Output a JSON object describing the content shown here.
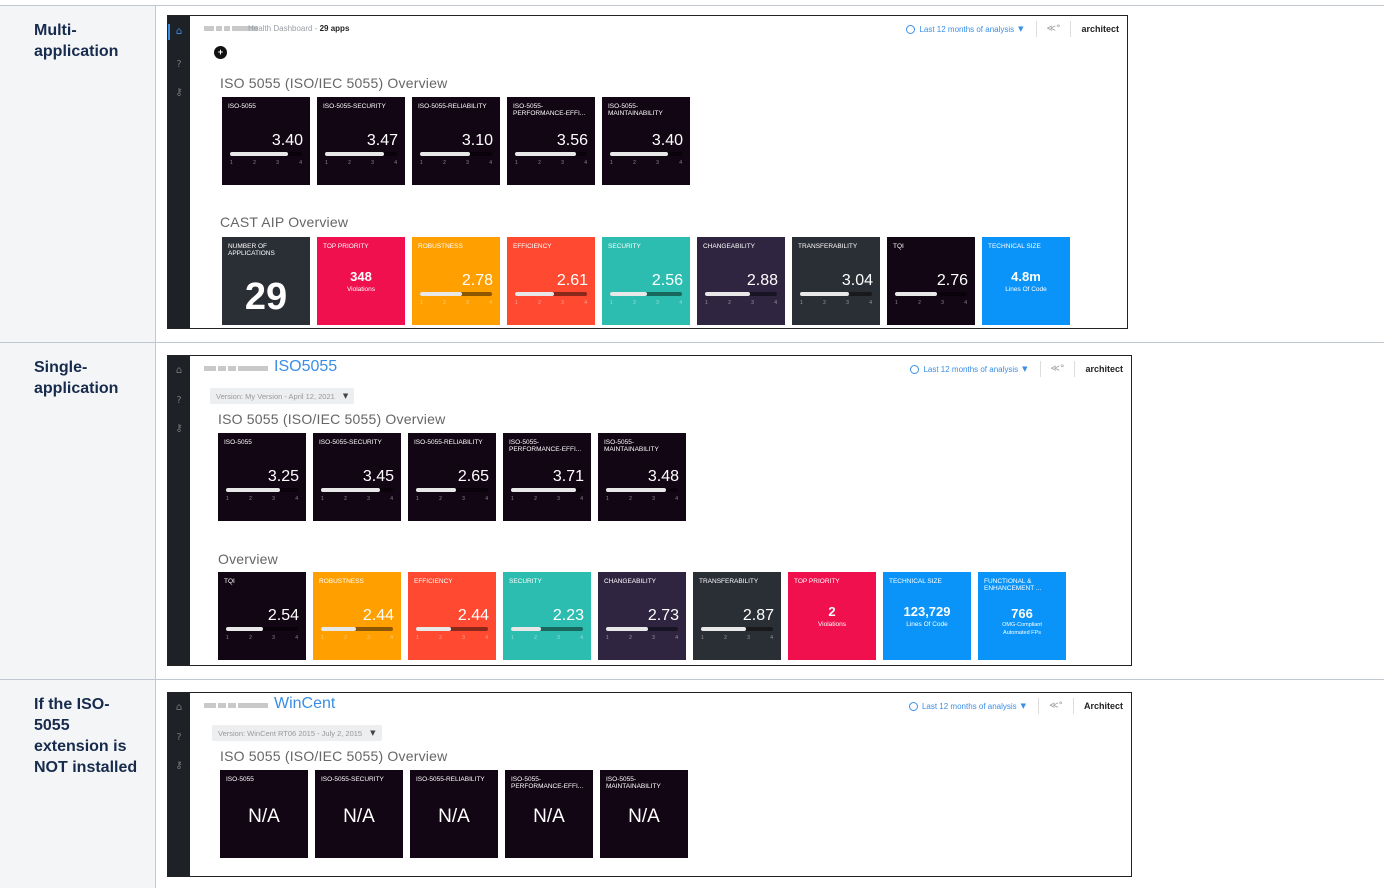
{
  "rows": [
    {
      "label": "Multi-application",
      "breadcrumb_title": "Health Dashboard",
      "breadcrumb_count": "29 apps",
      "period": "Last 12 months of analysis",
      "user": "architect",
      "iso_section_title": "ISO 5055 (ISO/IEC 5055) Overview",
      "iso_tiles": [
        {
          "label": "ISO-5055",
          "value": "3.40",
          "level": 0.8
        },
        {
          "label": "ISO-5055-SECURITY",
          "value": "3.47",
          "level": 0.82
        },
        {
          "label": "ISO-5055-RELIABILITY",
          "value": "3.10",
          "level": 0.7
        },
        {
          "label": "ISO-5055-PERFORMANCE-EFFI...",
          "value": "3.56",
          "level": 0.85
        },
        {
          "label": "ISO-5055-MAINTAINABILITY",
          "value": "3.40",
          "level": 0.8
        }
      ],
      "aip_section_title": "CAST AIP Overview",
      "aip_tiles": [
        {
          "kind": "count",
          "label": "NUMBER OF APPLICATIONS",
          "value": "29",
          "color": "#2a2e35"
        },
        {
          "kind": "count-sub",
          "label": "TOP PRIORITY",
          "value": "348",
          "sub": "Violations",
          "color": "#f0104d"
        },
        {
          "kind": "gauge",
          "label": "ROBUSTNESS",
          "value": "2.78",
          "level": 0.59,
          "color": "#ff9f00"
        },
        {
          "kind": "gauge",
          "label": "EFFICIENCY",
          "value": "2.61",
          "level": 0.54,
          "color": "#ff4930"
        },
        {
          "kind": "gauge",
          "label": "SECURITY",
          "value": "2.56",
          "level": 0.52,
          "color": "#2dbdb0"
        },
        {
          "kind": "gauge",
          "label": "CHANGEABILITY",
          "value": "2.88",
          "level": 0.63,
          "color": "#2f2540"
        },
        {
          "kind": "gauge",
          "label": "TRANSFERABILITY",
          "value": "3.04",
          "level": 0.68,
          "color": "#2a2e35"
        },
        {
          "kind": "gauge",
          "label": "TQI",
          "value": "2.76",
          "level": 0.59,
          "color": "#120514"
        },
        {
          "kind": "count-sub",
          "label": "TECHNICAL SIZE",
          "value": "4.8m",
          "sub": "Lines Of Code",
          "color": "#0a94f9"
        }
      ]
    },
    {
      "label": "Single-application",
      "app_title": "ISO5055",
      "version": "Version: My Version - April 12, 2021",
      "period": "Last 12 months of analysis",
      "user": "architect",
      "iso_section_title": "ISO 5055 (ISO/IEC 5055) Overview",
      "iso_tiles": [
        {
          "label": "ISO-5055",
          "value": "3.25",
          "level": 0.75
        },
        {
          "label": "ISO-5055-SECURITY",
          "value": "3.45",
          "level": 0.82
        },
        {
          "label": "ISO-5055-RELIABILITY",
          "value": "2.65",
          "level": 0.55
        },
        {
          "label": "ISO-5055-PERFORMANCE-EFFI...",
          "value": "3.71",
          "level": 0.9
        },
        {
          "label": "ISO-5055-MAINTAINABILITY",
          "value": "3.48",
          "level": 0.83
        }
      ],
      "aip_section_title": "Overview",
      "aip_tiles": [
        {
          "kind": "gauge",
          "label": "TQI",
          "value": "2.54",
          "level": 0.51,
          "color": "#120514"
        },
        {
          "kind": "gauge",
          "label": "ROBUSTNESS",
          "value": "2.44",
          "level": 0.48,
          "color": "#ff9f00"
        },
        {
          "kind": "gauge",
          "label": "EFFICIENCY",
          "value": "2.44",
          "level": 0.48,
          "color": "#ff4930"
        },
        {
          "kind": "gauge",
          "label": "SECURITY",
          "value": "2.23",
          "level": 0.41,
          "color": "#2dbdb0"
        },
        {
          "kind": "gauge",
          "label": "CHANGEABILITY",
          "value": "2.73",
          "level": 0.58,
          "color": "#2f2540"
        },
        {
          "kind": "gauge",
          "label": "TRANSFERABILITY",
          "value": "2.87",
          "level": 0.62,
          "color": "#2a2e35"
        },
        {
          "kind": "count-sub",
          "label": "TOP PRIORITY",
          "value": "2",
          "sub": "Violations",
          "color": "#f0104d"
        },
        {
          "kind": "count-sub",
          "label": "TECHNICAL SIZE",
          "value": "123,729",
          "sub": "Lines Of Code",
          "color": "#0a94f9"
        },
        {
          "kind": "count-sub2",
          "label": "FUNCTIONAL & ENHANCEMENT ...",
          "value": "766",
          "sub": "OMG-Compliant",
          "sub2": "Automated FPs",
          "color": "#0a94f9"
        }
      ]
    },
    {
      "label": "If the ISO-5055 extension is NOT installed",
      "app_title": "WinCent",
      "version": "Version: WinCent RT06 2015 - July 2, 2015",
      "period": "Last 12 months of analysis",
      "user": "Architect",
      "iso_section_title": "ISO 5055 (ISO/IEC 5055) Overview",
      "iso_tiles": [
        {
          "label": "ISO-5055",
          "value": "N/A"
        },
        {
          "label": "ISO-5055-SECURITY",
          "value": "N/A"
        },
        {
          "label": "ISO-5055-RELIABILITY",
          "value": "N/A"
        },
        {
          "label": "ISO-5055-PERFORMANCE-EFFI...",
          "value": "N/A"
        },
        {
          "label": "ISO-5055-MAINTAINABILITY",
          "value": "N/A"
        }
      ]
    }
  ],
  "scale_ticks": [
    "1",
    "2",
    "3",
    "4"
  ],
  "icons": {
    "home": "home-icon",
    "help": "help-icon",
    "key": "key-icon",
    "clock": "clock-icon",
    "caret": "caret-down-icon",
    "share": "share-icon",
    "add": "add-icon"
  },
  "colors": {
    "iso_tile": "#120514",
    "accent": "#3a8ee6",
    "sidebar": "#1e2126"
  }
}
